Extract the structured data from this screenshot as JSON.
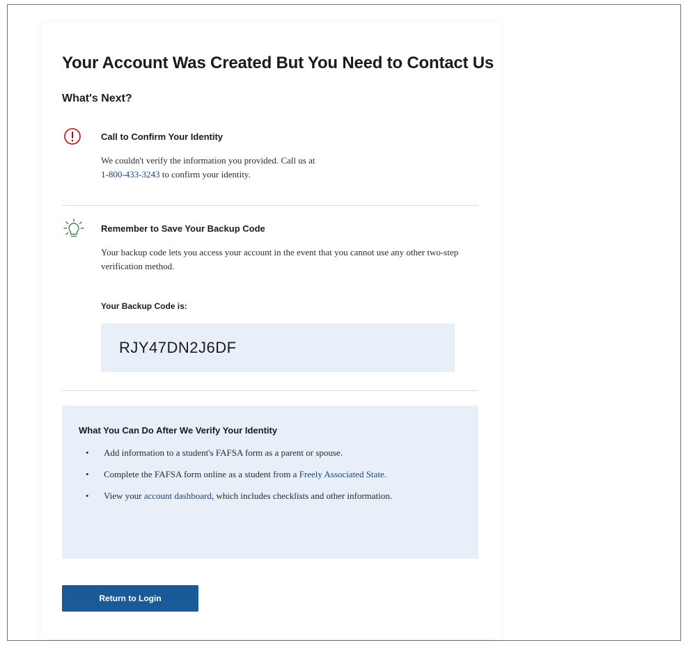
{
  "page": {
    "title": "Your Account Was Created But You Need to Contact Us",
    "subheading": "What's Next?"
  },
  "confirm": {
    "heading": "Call to Confirm Your Identity",
    "text_before": "We couldn't verify the information you provided. Call us at",
    "phone": "1-800-433-3243",
    "text_after": " to confirm your identity."
  },
  "backup": {
    "heading": "Remember to Save Your Backup Code",
    "text": "Your backup code lets you access your account in the event that you cannot use any other two-step verification method.",
    "code_label": "Your Backup Code is:",
    "code": "RJY47DN2J6DF"
  },
  "after_verify": {
    "title": "What You Can Do After We Verify Your Identity",
    "item1": "Add information to a student's FAFSA form as a parent or spouse.",
    "item2_before": "Complete the FAFSA form online as a student from a ",
    "item2_link": "Freely Associated State",
    "item2_after": ".",
    "item3_before": "View your ",
    "item3_link": "account dashboard",
    "item3_after": ", which includes checklists and other information."
  },
  "actions": {
    "return_label": "Return to Login"
  },
  "colors": {
    "alert": "#b50909",
    "tip": "#4d8055",
    "link": "#1a4480",
    "button": "#1a5a96",
    "panel": "#e8eff8"
  }
}
